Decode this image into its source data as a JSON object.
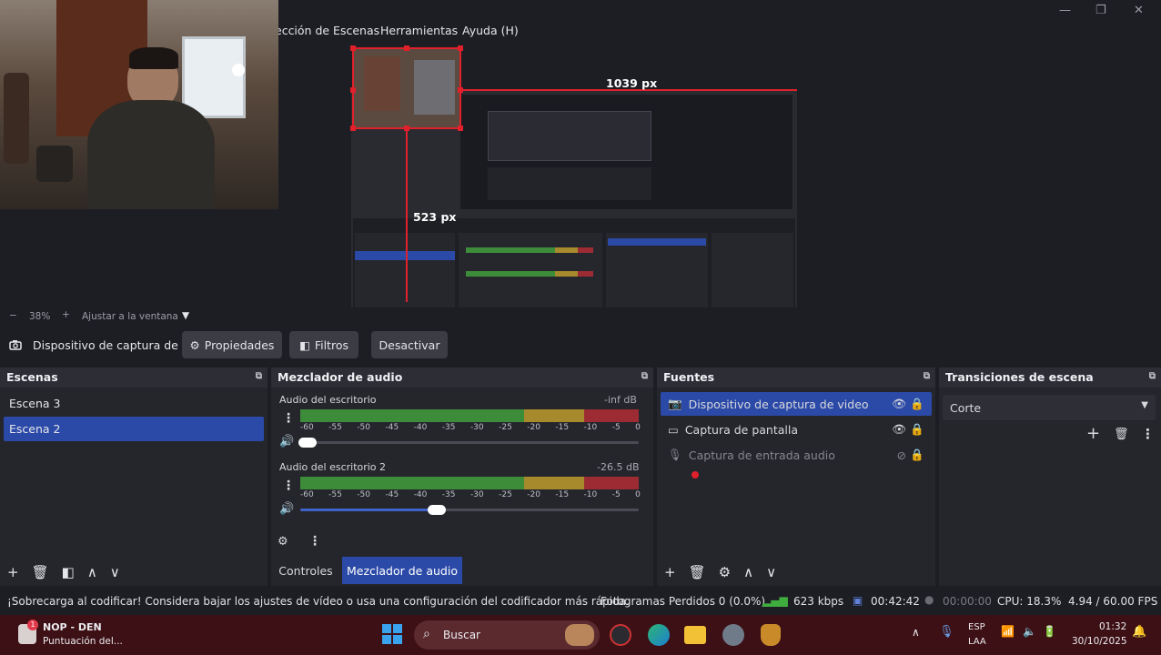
{
  "menu": {
    "items": [
      "ección de Escenas",
      "Herramientas",
      "Ayuda (H)"
    ]
  },
  "window_controls": {
    "minimize": "—",
    "maximize": "❐",
    "close": "✕"
  },
  "preview": {
    "width_label": "1039 px",
    "height_label": "523 px"
  },
  "zoom": {
    "minus": "−",
    "value": "38%",
    "plus": "+",
    "fit_label": "Ajustar a la ventana",
    "dropdown": "▼"
  },
  "source_toolbar": {
    "source_name": "Dispositivo de captura de v",
    "properties": "Propiedades",
    "filters": "Filtros",
    "deactivate": "Desactivar"
  },
  "scenes": {
    "title": "Escenas",
    "items": [
      {
        "label": "Escena 3",
        "selected": false
      },
      {
        "label": "Escena 2",
        "selected": true
      }
    ]
  },
  "mixer": {
    "title": "Mezclador de audio",
    "channels": [
      {
        "name": "Audio del escritorio",
        "level": "-inf dB",
        "volume_fraction": 0.05
      },
      {
        "name": "Audio del escritorio 2",
        "level": "-26.5 dB",
        "volume_fraction": 0.4
      }
    ],
    "ticks": [
      "-60",
      "-55",
      "-50",
      "-45",
      "-40",
      "-35",
      "-30",
      "-25",
      "-20",
      "-15",
      "-10",
      "-5",
      "0"
    ],
    "tab_controls": "Controles",
    "tab_mixer": "Mezclador de audio"
  },
  "sources": {
    "title": "Fuentes",
    "items": [
      {
        "label": "Dispositivo de captura de video",
        "icon": "camera-icon",
        "visible": true,
        "selected": true
      },
      {
        "label": "Captura de pantalla",
        "icon": "monitor-icon",
        "visible": true,
        "selected": false
      },
      {
        "label": "Captura de entrada audio",
        "icon": "microphone-icon",
        "visible": false,
        "selected": false
      }
    ]
  },
  "transitions": {
    "title": "Transiciones de escena",
    "selected": "Corte"
  },
  "status": {
    "warning": "¡Sobrecarga al codificar! Considera bajar los ajustes de vídeo o usa una configuración del codificador más rápida.",
    "frames": "Fotogramas Perdidos 0 (0.0%)",
    "bitrate": "623 kbps",
    "rec_time": "00:42:42",
    "stream_time": "00:00:00",
    "cpu": "CPU: 18.3%",
    "fps": "4.94 / 60.00 FPS"
  },
  "taskbar": {
    "notification_title": "NOP - DEN",
    "notification_sub": "Puntuación del...",
    "badge": "1",
    "search": "Buscar",
    "lang_top": "ESP",
    "lang_bottom": "LAA",
    "time": "01:32",
    "date": "30/10/2025"
  },
  "colors": {
    "accent": "#2b4aa8",
    "meter_green": "#3d8c3a",
    "meter_yellow": "#a78a2c",
    "meter_red": "#9c2b33",
    "guide_red": "#e0202a",
    "taskbar": "#3c1014"
  }
}
